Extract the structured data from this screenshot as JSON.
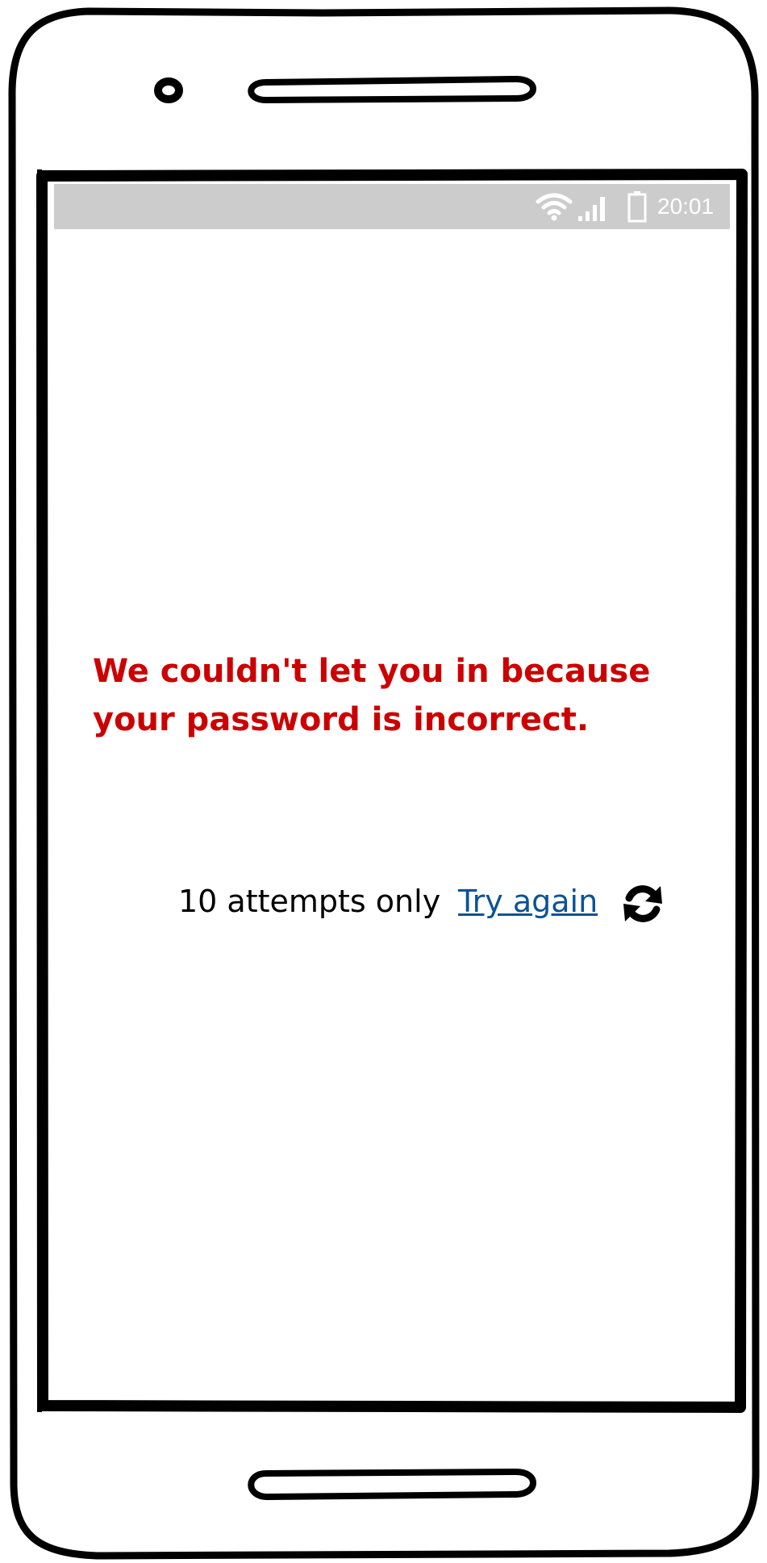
{
  "status_bar": {
    "time": "20:01",
    "icons": [
      "wifi-icon",
      "signal-icon",
      "battery-icon"
    ]
  },
  "error": {
    "message": "We couldn't let you in because your password is incorrect.",
    "color": "#cc0000"
  },
  "retry": {
    "attempts_text": "10 attempts only",
    "try_again_label": "Try again",
    "link_color": "#0b5394",
    "icon": "refresh-icon"
  }
}
